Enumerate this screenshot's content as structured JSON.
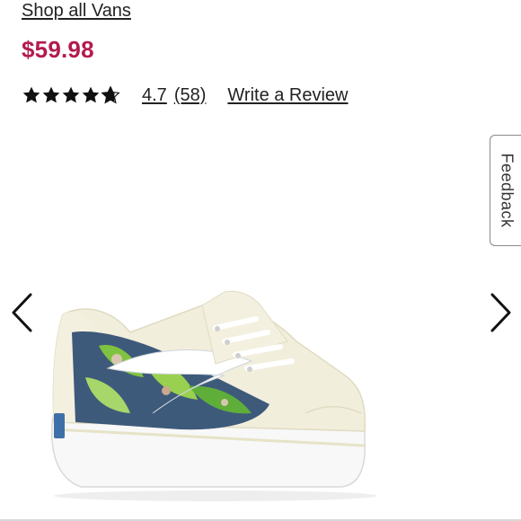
{
  "product": {
    "brand_link": "Shop all Vans",
    "price": "$59.98",
    "rating": {
      "stars": 4.7,
      "value": "4.7",
      "count": "(58)",
      "write_review": "Write a Review"
    }
  },
  "feedback": {
    "label": "Feedback"
  },
  "gallery": {
    "prev_icon": "chevron-left-icon",
    "next_icon": "chevron-right-icon",
    "image_subject": "sneaker-image"
  },
  "colors": {
    "price": "#b31b4e",
    "text": "#222222",
    "star": "#111111"
  }
}
